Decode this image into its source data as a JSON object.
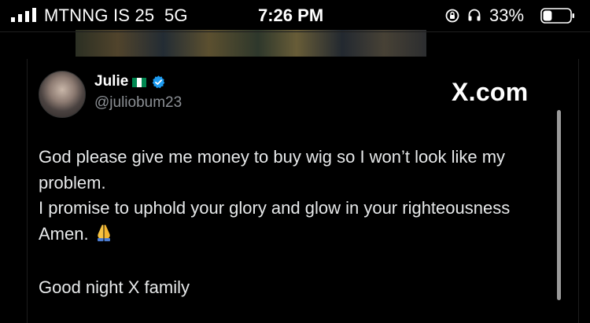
{
  "status_bar": {
    "carrier": "MTNNG IS 25",
    "network": "5G",
    "time": "7:26 PM",
    "battery_percent": "33%",
    "battery_level": 0.33,
    "signal_bars_filled": 4,
    "icons": [
      "signal-icon",
      "orientation-lock-icon",
      "headphones-icon",
      "battery-icon"
    ]
  },
  "tweet": {
    "display_name": "Julie",
    "flag": "Nigeria flag",
    "handle": "@juliobum23",
    "verified": true,
    "brand": "X.com",
    "body": "God please give me money to buy wig so I won’t look like my problem.\nI promise to uphold your glory and glow in your righteousness Amen.",
    "footer": "Good night X family",
    "emoji": "🙏"
  },
  "colors": {
    "background": "#000000",
    "text": "#e7e9ea",
    "muted": "#8b8f94",
    "verified_blue": "#1d9bf0",
    "flag_green": "#008751"
  }
}
